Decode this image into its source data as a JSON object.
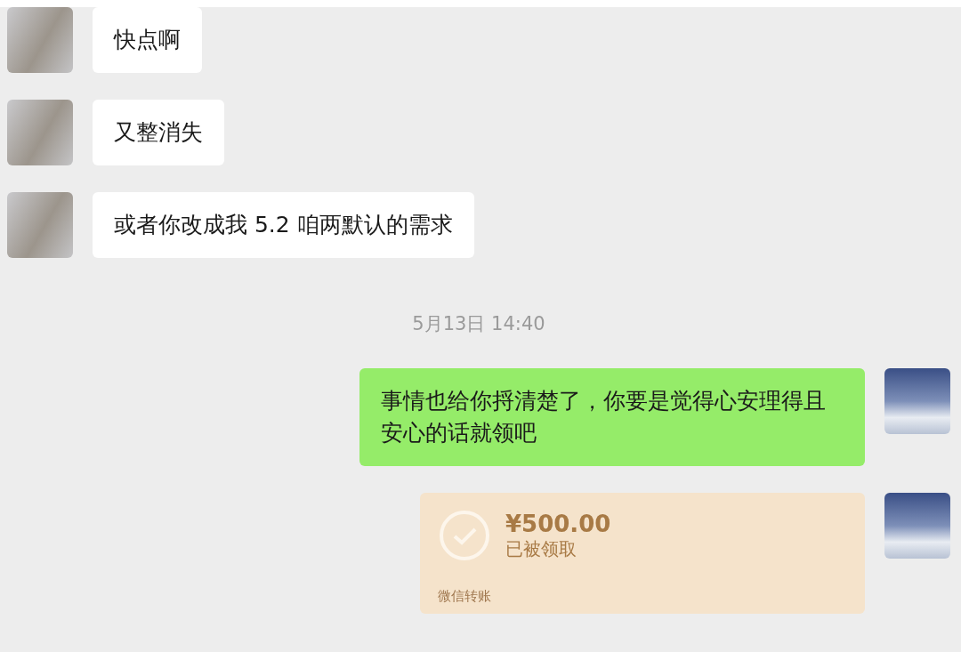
{
  "messages": [
    {
      "kind": "text",
      "outgoing": false,
      "text": "快点啊"
    },
    {
      "kind": "text",
      "outgoing": false,
      "text": "又整消失"
    },
    {
      "kind": "text",
      "outgoing": false,
      "text": "或者你改成我 5.2 咱两默认的需求"
    },
    {
      "kind": "time",
      "text": "5月13日 14:40"
    },
    {
      "kind": "text",
      "outgoing": true,
      "text": "事情也给你捋清楚了，你要是觉得心安理得且安心的话就领吧"
    },
    {
      "kind": "transfer",
      "outgoing": true,
      "amount": "¥500.00",
      "status": "已被领取",
      "footer": "微信转账"
    }
  ]
}
